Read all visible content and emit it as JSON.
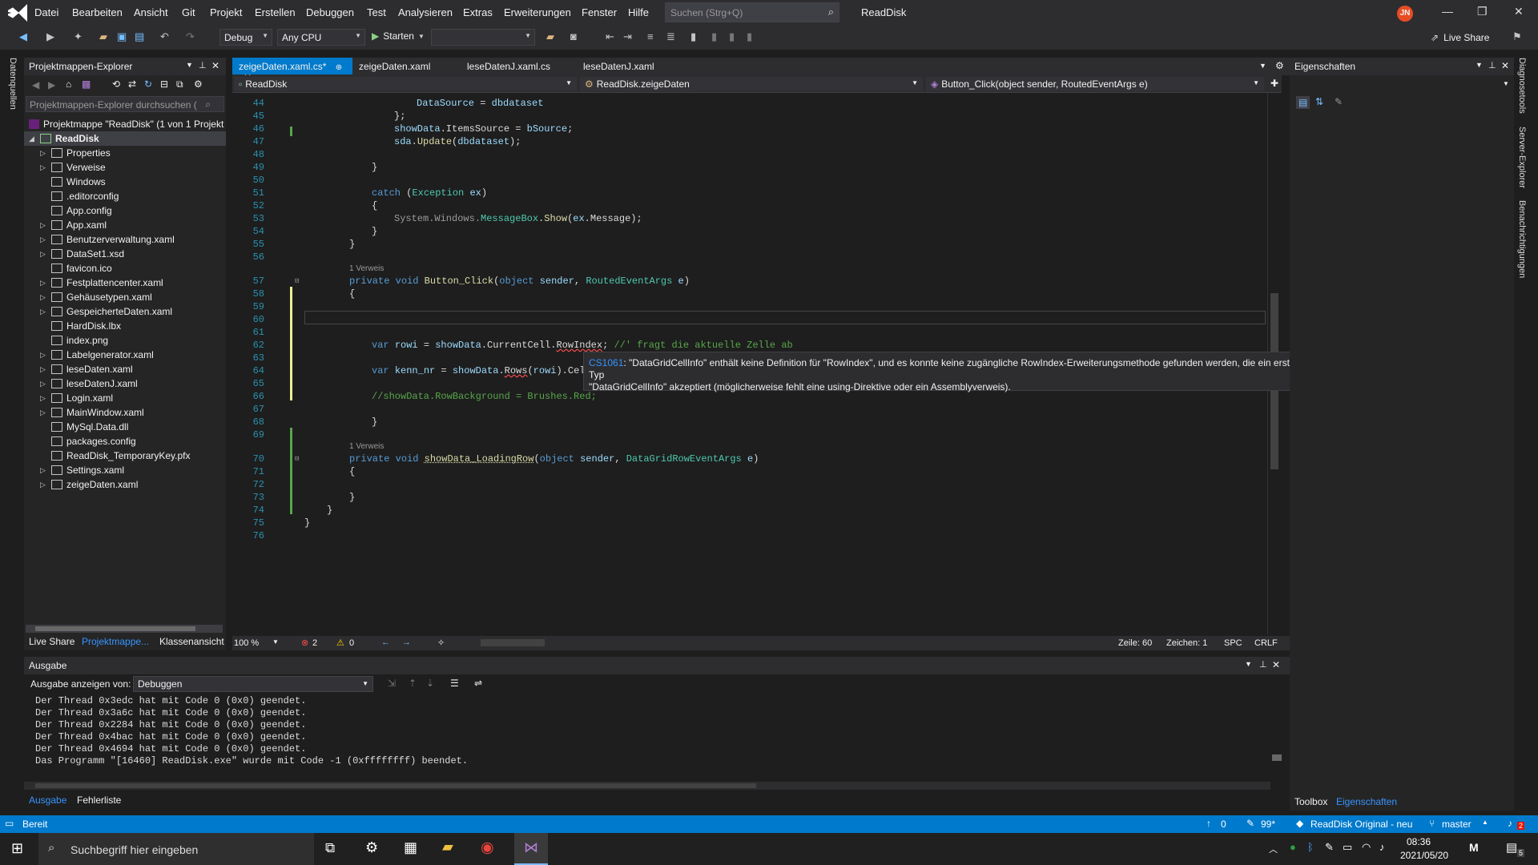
{
  "menubar": {
    "items": [
      "Datei",
      "Bearbeiten",
      "Ansicht",
      "Git",
      "Projekt",
      "Erstellen",
      "Debuggen",
      "Test",
      "Analysieren",
      "Extras",
      "Erweiterungen",
      "Fenster",
      "Hilfe"
    ],
    "search_placeholder": "Suchen (Strg+Q)",
    "solution_name": "ReadDisk",
    "avatar_initials": "JN"
  },
  "toolbar": {
    "config": "Debug",
    "platform": "Any CPU",
    "start_label": "Starten",
    "live_share": "Live Share"
  },
  "solution_explorer": {
    "title": "Projektmappen-Explorer",
    "search_placeholder": "Projektmappen-Explorer durchsuchen (",
    "solution": "Projektmappe \"ReadDisk\" (1 von 1 Projekt",
    "project": "ReadDisk",
    "items": [
      {
        "label": "Properties",
        "arrow": true
      },
      {
        "label": "Verweise",
        "arrow": true
      },
      {
        "label": "Windows",
        "arrow": false
      },
      {
        "label": ".editorconfig",
        "arrow": false
      },
      {
        "label": "App.config",
        "arrow": false
      },
      {
        "label": "App.xaml",
        "arrow": true
      },
      {
        "label": "Benutzerverwaltung.xaml",
        "arrow": true
      },
      {
        "label": "DataSet1.xsd",
        "arrow": true
      },
      {
        "label": "favicon.ico",
        "arrow": false
      },
      {
        "label": "Festplattencenter.xaml",
        "arrow": true
      },
      {
        "label": "Gehäusetypen.xaml",
        "arrow": true
      },
      {
        "label": "GespeicherteDaten.xaml",
        "arrow": true
      },
      {
        "label": "HardDisk.lbx",
        "arrow": false
      },
      {
        "label": "index.png",
        "arrow": false
      },
      {
        "label": "Labelgenerator.xaml",
        "arrow": true
      },
      {
        "label": "leseDaten.xaml",
        "arrow": true
      },
      {
        "label": "leseDatenJ.xaml",
        "arrow": true
      },
      {
        "label": "Login.xaml",
        "arrow": true
      },
      {
        "label": "MainWindow.xaml",
        "arrow": true
      },
      {
        "label": "MySql.Data.dll",
        "arrow": false
      },
      {
        "label": "packages.config",
        "arrow": false
      },
      {
        "label": "ReadDisk_TemporaryKey.pfx",
        "arrow": false
      },
      {
        "label": "Settings.xaml",
        "arrow": true
      },
      {
        "label": "zeigeDaten.xaml",
        "arrow": true
      }
    ],
    "bottom_tabs": [
      "Live Share",
      "Projektmappe...",
      "Klassenansicht"
    ]
  },
  "editor": {
    "tabs": [
      "zeigeDaten.xaml.cs*",
      "zeigeDaten.xaml",
      "leseDatenJ.xaml.cs",
      "leseDatenJ.xaml"
    ],
    "nav_project": "ReadDisk",
    "nav_class": "ReadDisk.zeigeDaten",
    "nav_member": "Button_Click(object sender, RoutedEventArgs e)",
    "ref1": "1 Verweis",
    "ref2": "1 Verweis",
    "zoom": "100 %",
    "errors": "2",
    "warnings": "0",
    "line": "Zeile: 60",
    "char": "Zeichen: 1",
    "spc": "SPC",
    "crlf": "CRLF"
  },
  "tooltip": {
    "code": "CS1061",
    "line1": ": \"DataGridCellInfo\" enthält keine Definition für \"RowIndex\", und es konnte keine zugängliche RowIndex-Erweiterungsmethode gefunden werden, die ein erstes Argument vom Typ",
    "line2": "\"DataGridCellInfo\" akzeptiert (möglicherweise fehlt eine using-Direktive oder ein Assemblyverweis)."
  },
  "properties": {
    "title": "Eigenschaften",
    "bottom_tabs": [
      "Toolbox",
      "Eigenschaften"
    ]
  },
  "side_tabs": {
    "left": "Datenquellen",
    "right": [
      "Diagnosetools",
      "Server-Explorer",
      "Benachrichtigungen"
    ]
  },
  "output": {
    "title": "Ausgabe",
    "source_label": "Ausgabe anzeigen von:",
    "source": "Debuggen",
    "lines": [
      "Der Thread 0x3edc hat mit Code 0 (0x0) geendet.",
      "Der Thread 0x3a6c hat mit Code 0 (0x0) geendet.",
      "Der Thread 0x2284 hat mit Code 0 (0x0) geendet.",
      "Der Thread 0x4bac hat mit Code 0 (0x0) geendet.",
      "Der Thread 0x4694 hat mit Code 0 (0x0) geendet.",
      "Das Programm \"[16460] ReadDisk.exe\" wurde mit Code -1 (0xffffffff) beendet."
    ],
    "tabs": [
      "Ausgabe",
      "Fehlerliste"
    ]
  },
  "statusbar": {
    "ready": "Bereit",
    "up": "0",
    "pencil": "99*",
    "repo": "ReadDisk Original - neu",
    "branch": "master",
    "notify": "2"
  },
  "taskbar": {
    "search_placeholder": "Suchbegriff hier eingeben",
    "time": "08:36",
    "date": "2021/05/20",
    "notifications": "5"
  }
}
